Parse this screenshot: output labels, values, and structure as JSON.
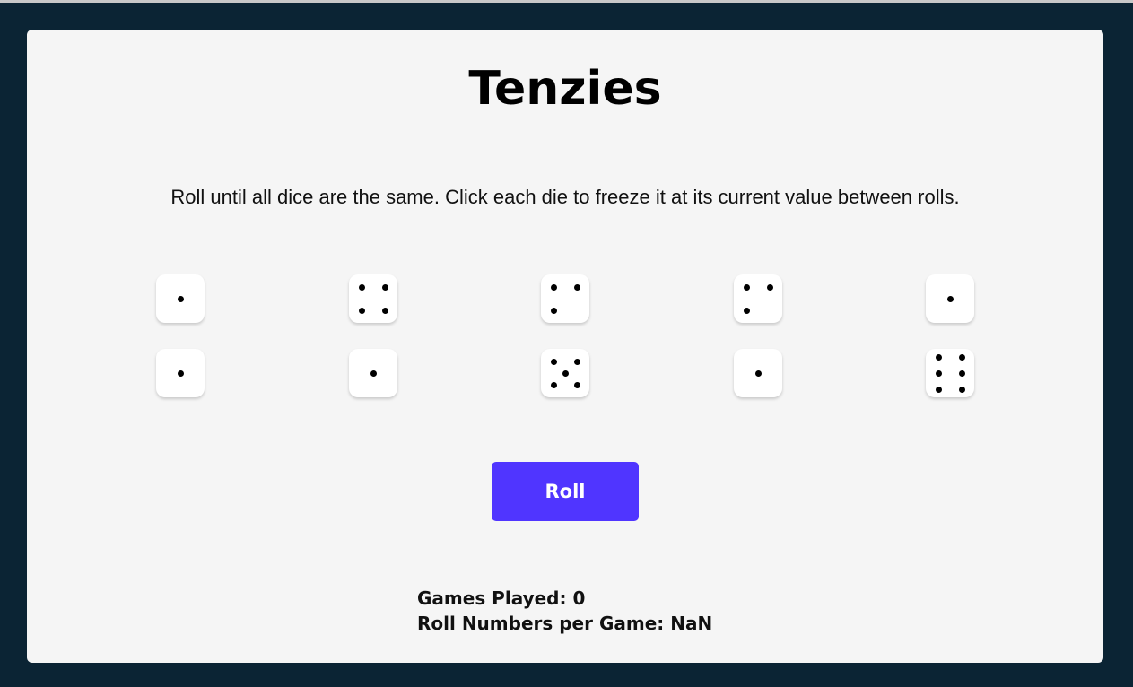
{
  "game": {
    "title": "Tenzies",
    "instructions": "Roll until all dice are the same. Click each die to freeze it at its current value between rolls.",
    "dice": [
      1,
      4,
      3,
      3,
      1,
      1,
      1,
      5,
      1,
      6
    ],
    "roll_label": "Roll"
  },
  "stats": {
    "games_played_label": "Games Played:",
    "games_played_value": "0",
    "roll_numbers_label": "Roll Numbers per Game:",
    "roll_numbers_value": "NaN"
  },
  "colors": {
    "background": "#0b2434",
    "board": "#f5f5f5",
    "accent": "#5035ff",
    "die": "#ffffff",
    "pip": "#000000"
  }
}
